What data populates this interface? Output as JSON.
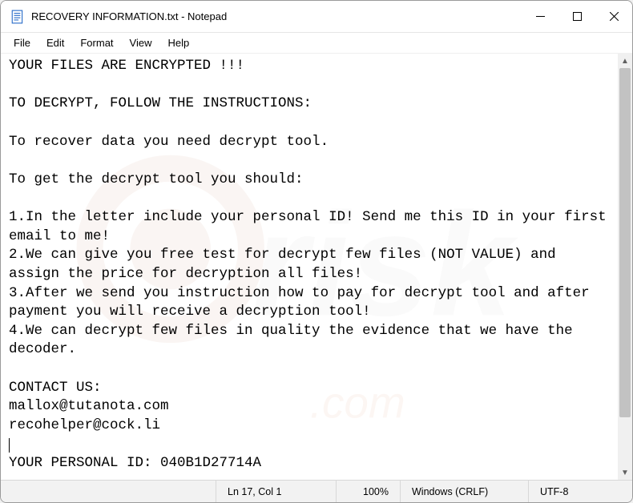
{
  "titlebar": {
    "title": "RECOVERY INFORMATION.txt - Notepad"
  },
  "menubar": {
    "file": "File",
    "edit": "Edit",
    "format": "Format",
    "view": "View",
    "help": "Help"
  },
  "document": {
    "line1": "YOUR FILES ARE ENCRYPTED !!!",
    "line2": "",
    "line3": "TO DECRYPT, FOLLOW THE INSTRUCTIONS:",
    "line4": "",
    "line5": "To recover data you need decrypt tool.",
    "line6": "",
    "line7": "To get the decrypt tool you should:",
    "line8": "",
    "line9": "1.In the letter include your personal ID! Send me this ID in your first email to me!",
    "line10": "2.We can give you free test for decrypt few files (NOT VALUE) and assign the price for decryption all files!",
    "line11": "3.After we send you instruction how to pay for decrypt tool and after payment you will receive a decryption tool!",
    "line12": "4.We can decrypt few files in quality the evidence that we have the decoder.",
    "line13": "",
    "line14": "CONTACT US:",
    "line15": "mallox@tutanota.com",
    "line16": "recohelper@cock.li",
    "line17": "",
    "line18": "YOUR PERSONAL ID: 040B1D27714A"
  },
  "statusbar": {
    "position": "Ln 17, Col 1",
    "zoom": "100%",
    "eol": "Windows (CRLF)",
    "encoding": "UTF-8"
  }
}
